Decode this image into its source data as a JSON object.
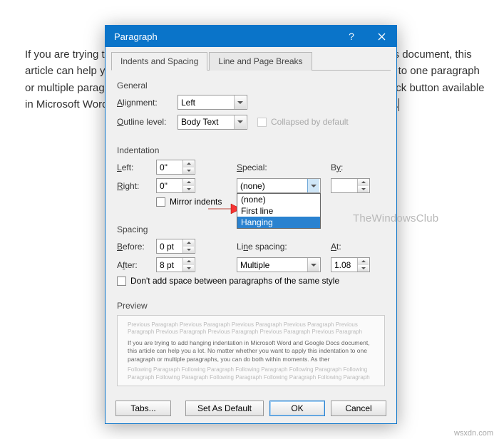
{
  "bg_text": "If you are trying to add hanging indentation in Microsoft Word and Google Docs document, this article can help you a lot. No matter whether you want to apply this indentation to one paragraph or multiple paragraphs, you can do both within moments. As there is no one-click button available in Microsoft Word or Google Docs, you might need to check out the steps here.",
  "dialog": {
    "title": "Paragraph",
    "tabs": {
      "indents": "Indents and Spacing",
      "breaks": "Line and Page Breaks"
    },
    "general": {
      "title": "General",
      "alignment_label": "Alignment:",
      "alignment_value": "Left",
      "outline_label": "Outline level:",
      "outline_value": "Body Text",
      "collapsed_label": "Collapsed by default"
    },
    "indent": {
      "title": "Indentation",
      "left_label": "Left:",
      "left_value": "0\"",
      "right_label": "Right:",
      "right_value": "0\"",
      "special_label": "Special:",
      "special_value": "(none)",
      "by_label": "By:",
      "by_value": "",
      "mirror_label": "Mirror indents",
      "options": {
        "none": "(none)",
        "first": "First line",
        "hanging": "Hanging"
      }
    },
    "spacing": {
      "title": "Spacing",
      "before_label": "Before:",
      "before_value": "0 pt",
      "after_label": "After:",
      "after_value": "8 pt",
      "line_label": "Line spacing:",
      "line_value": "Multiple",
      "at_label": "At:",
      "at_value": "1.08",
      "no_space_label": "Don't add space between paragraphs of the same style"
    },
    "preview": {
      "title": "Preview",
      "placeholder": "Previous Paragraph Previous Paragraph Previous Paragraph Previous Paragraph Previous Paragraph Previous Paragraph Previous Paragraph Previous Paragraph Previous Paragraph",
      "sample": "If you are trying to add hanging indentation in Microsoft Word and Google Docs document, this article can help you a lot. No matter whether you want to apply this indentation to one paragraph or multiple paragraphs, you can do both within moments. As ther",
      "following": "Following Paragraph Following Paragraph Following Paragraph Following Paragraph Following Paragraph Following Paragraph Following Paragraph Following Paragraph Following Paragraph"
    },
    "buttons": {
      "tabs": "Tabs...",
      "default": "Set As Default",
      "ok": "OK",
      "cancel": "Cancel"
    }
  },
  "watermark": "TheWindowsClub",
  "footer_credit": "wsxdn.com"
}
